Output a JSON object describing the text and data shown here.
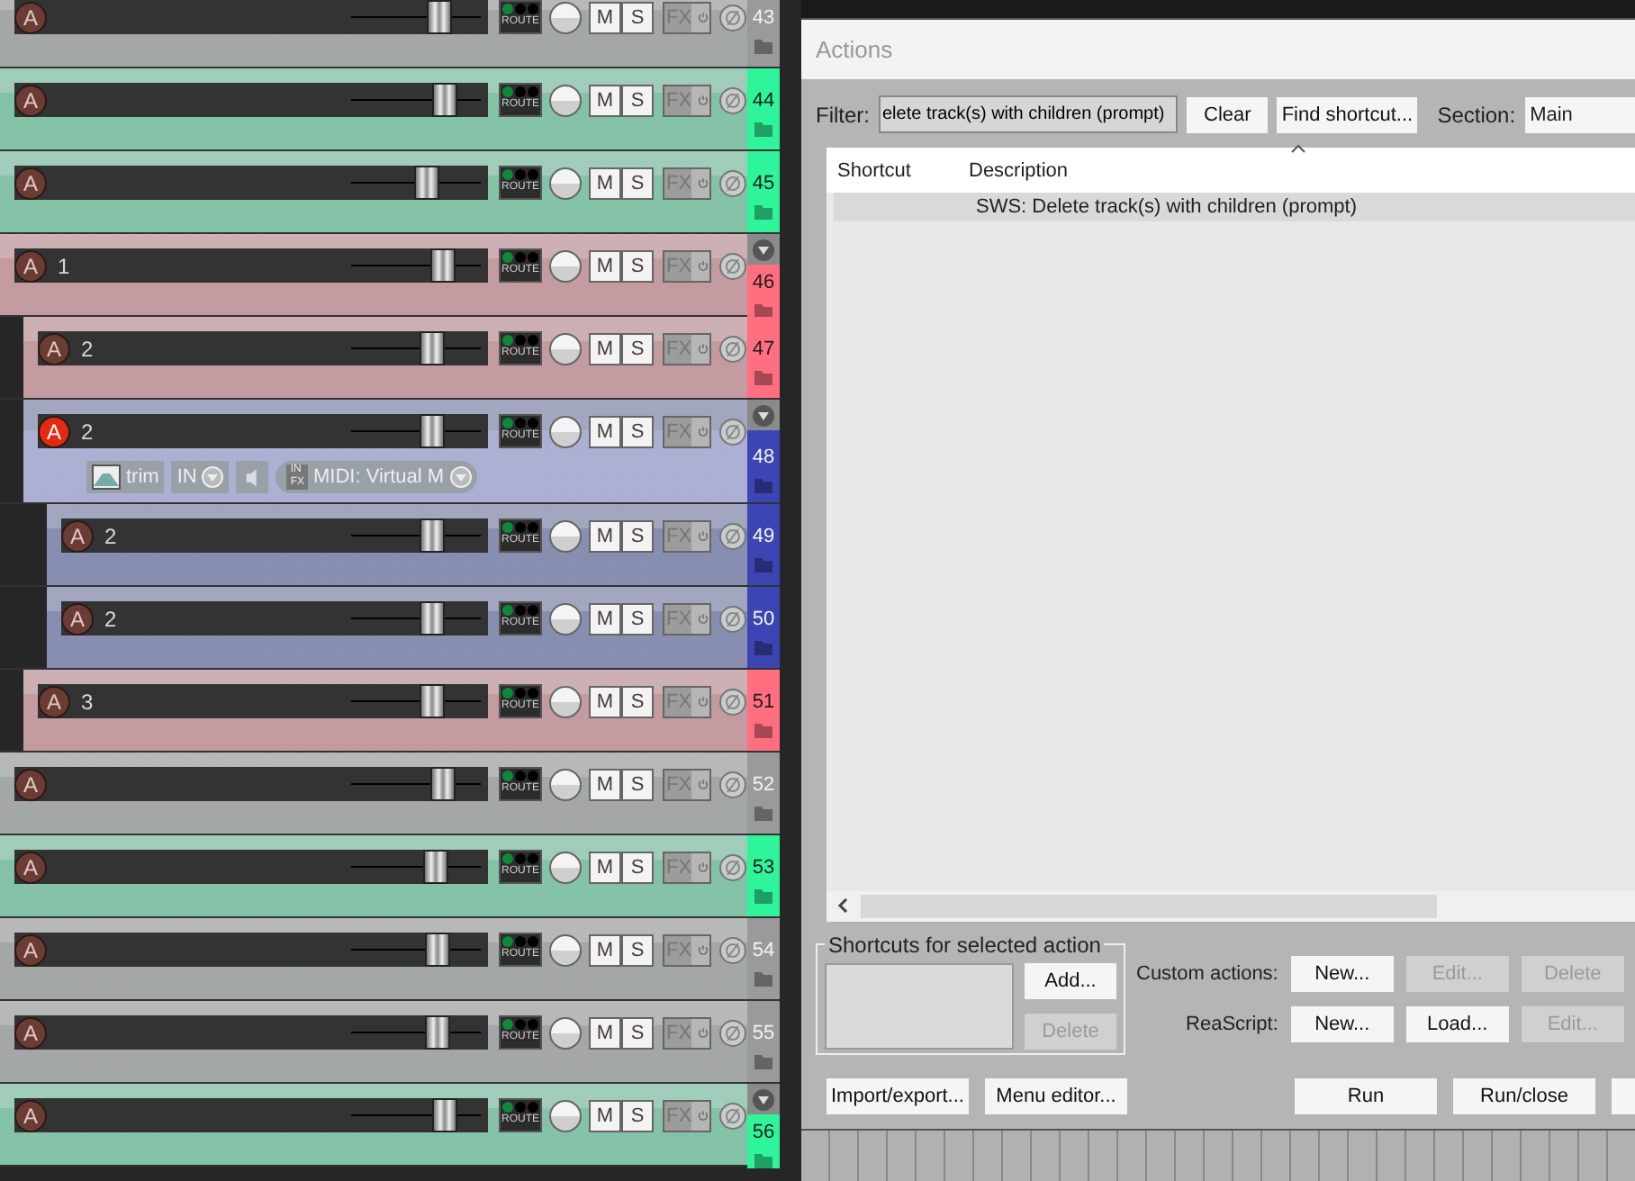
{
  "tracks": [
    {
      "number": "43",
      "color": "#9a9a9a",
      "arm_label": "A",
      "armed": false,
      "selected": false,
      "folder": false,
      "level": 0.68,
      "route": "ROUTE",
      "mute": "M",
      "solo": "S",
      "fx": "FX"
    },
    {
      "number": "44",
      "color": "#2ef59a",
      "arm_label": "A",
      "armed": false,
      "selected": false,
      "folder": false,
      "level": 0.72,
      "route": "ROUTE",
      "mute": "M",
      "solo": "S",
      "fx": "FX"
    },
    {
      "number": "45",
      "color": "#2ef59a",
      "arm_label": "A",
      "armed": false,
      "selected": false,
      "folder": false,
      "level": 0.58,
      "route": "ROUTE",
      "mute": "M",
      "solo": "S",
      "fx": "FX"
    },
    {
      "number": "46",
      "name": "1",
      "color": "#ff6f80",
      "arm_label": "A",
      "armed": false,
      "selected": false,
      "folder": true,
      "level": 0.71,
      "route": "ROUTE",
      "mute": "M",
      "solo": "S",
      "fx": "FX",
      "children": [
        {
          "number": "47",
          "name": "2",
          "color": "#ff6f80",
          "arm_label": "A",
          "armed": false,
          "selected": false,
          "folder": false,
          "level": 0.63,
          "route": "ROUTE",
          "mute": "M",
          "solo": "S",
          "fx": "FX"
        },
        {
          "number": "48",
          "name": "2",
          "color": "#3b46b4",
          "arm_label": "A",
          "armed": true,
          "selected": true,
          "folder": true,
          "level": 0.63,
          "route": "ROUTE",
          "mute": "M",
          "solo": "S",
          "fx": "FX",
          "input_row": {
            "trim": "trim",
            "input": "IN",
            "badge_top": "IN",
            "badge_bottom": "FX",
            "midi": "MIDI: Virtual M"
          },
          "children": [
            {
              "number": "49",
              "name": "2",
              "color": "#3b46b4",
              "arm_label": "A",
              "armed": false,
              "selected": false,
              "folder": false,
              "level": 0.63,
              "route": "ROUTE",
              "mute": "M",
              "solo": "S",
              "fx": "FX"
            },
            {
              "number": "50",
              "name": "2",
              "color": "#3b46b4",
              "arm_label": "A",
              "armed": false,
              "selected": false,
              "folder": false,
              "level": 0.63,
              "route": "ROUTE",
              "mute": "M",
              "solo": "S",
              "fx": "FX"
            }
          ]
        },
        {
          "number": "51",
          "name": "3",
          "color": "#ff6f80",
          "arm_label": "A",
          "armed": false,
          "selected": false,
          "folder": false,
          "level": 0.63,
          "route": "ROUTE",
          "mute": "M",
          "solo": "S",
          "fx": "FX"
        }
      ]
    },
    {
      "number": "52",
      "color": "#9a9a9a",
      "arm_label": "A",
      "armed": false,
      "selected": false,
      "folder": false,
      "level": 0.71,
      "route": "ROUTE",
      "mute": "M",
      "solo": "S",
      "fx": "FX"
    },
    {
      "number": "53",
      "color": "#2ef59a",
      "arm_label": "A",
      "armed": false,
      "selected": false,
      "folder": false,
      "level": 0.65,
      "route": "ROUTE",
      "mute": "M",
      "solo": "S",
      "fx": "FX"
    },
    {
      "number": "54",
      "color": "#9a9a9a",
      "arm_label": "A",
      "armed": false,
      "selected": false,
      "folder": false,
      "level": 0.67,
      "route": "ROUTE",
      "mute": "M",
      "solo": "S",
      "fx": "FX"
    },
    {
      "number": "55",
      "color": "#9a9a9a",
      "arm_label": "A",
      "armed": false,
      "selected": false,
      "folder": false,
      "level": 0.67,
      "route": "ROUTE",
      "mute": "M",
      "solo": "S",
      "fx": "FX"
    },
    {
      "number": "56",
      "color": "#2ef59a",
      "arm_label": "A",
      "armed": false,
      "selected": false,
      "folder": true,
      "level": 0.72,
      "route": "ROUTE",
      "mute": "M",
      "solo": "S",
      "fx": "FX"
    }
  ],
  "dialog": {
    "title": "Actions",
    "filter": {
      "label": "Filter:",
      "value": "elete track(s) with children (prompt)"
    },
    "clear_button": "Clear",
    "find_button": "Find shortcut...",
    "section": {
      "label": "Section:",
      "value": "Main"
    },
    "table": {
      "columns": [
        "Shortcut",
        "Description"
      ],
      "rows": [
        {
          "shortcut": "",
          "description": "SWS: Delete track(s) with children (prompt)",
          "selected": true
        }
      ]
    },
    "shortcuts_group": {
      "title": "Shortcuts for selected action",
      "buttons": [
        {
          "label": "Add...",
          "disabled": false
        },
        {
          "label": "Delete",
          "disabled": true
        }
      ]
    },
    "custom_actions": {
      "label": "Custom actions:",
      "buttons": [
        {
          "label": "New...",
          "disabled": false
        },
        {
          "label": "Edit...",
          "disabled": true
        },
        {
          "label": "Delete",
          "disabled": true
        }
      ]
    },
    "reascript": {
      "label": "ReaScript:",
      "buttons": [
        {
          "label": "New...",
          "disabled": false
        },
        {
          "label": "Load...",
          "disabled": false
        },
        {
          "label": "Edit...",
          "disabled": true
        }
      ]
    },
    "bottom_left": [
      "Import/export...",
      "Menu editor..."
    ],
    "bottom_right": [
      "Run",
      "Run/close"
    ]
  }
}
